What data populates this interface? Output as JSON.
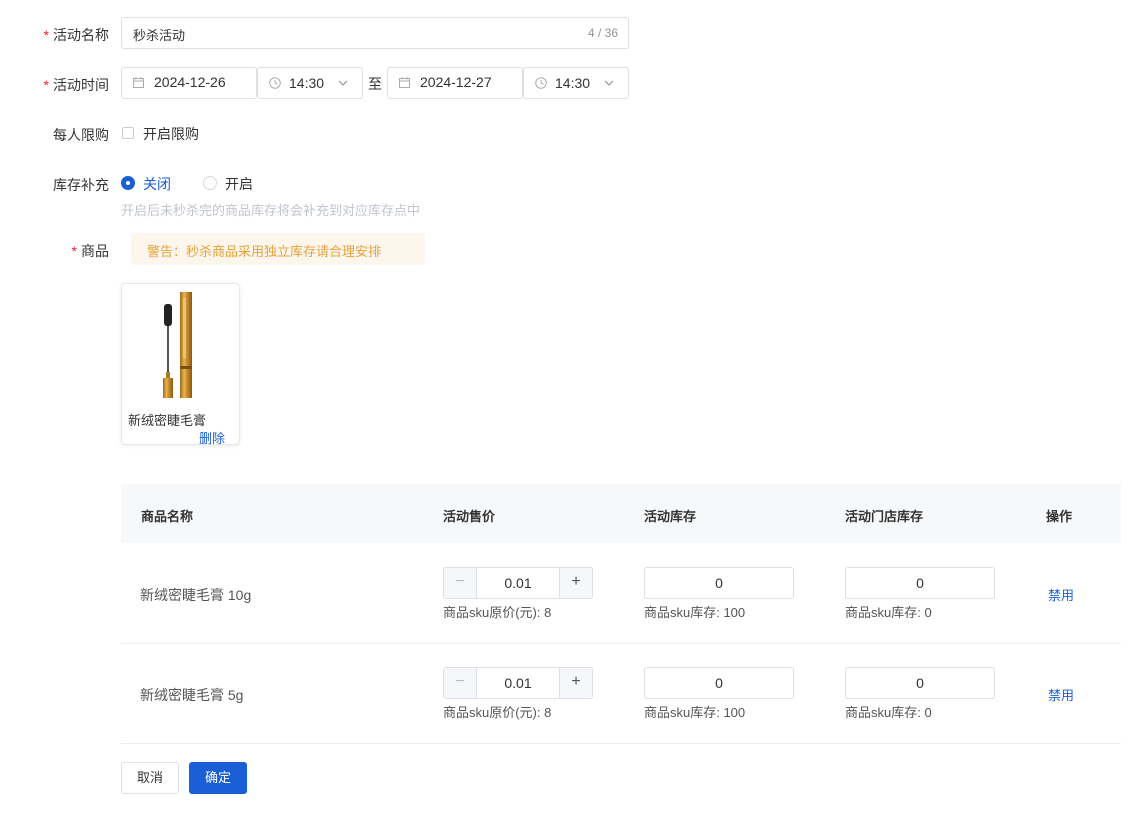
{
  "form": {
    "activity_name": {
      "label": "活动名称",
      "required_mark": "*",
      "value": "秒杀活动",
      "count": "4 / 36"
    },
    "activity_time": {
      "label": "活动时间",
      "required_mark": "*",
      "start_date": "2024-12-26",
      "start_time": "14:30",
      "separator": "至",
      "end_date": "2024-12-27",
      "end_time": "14:30"
    },
    "purchase_limit": {
      "label": "每人限购",
      "checkbox_label": "开启限购",
      "checked": false
    },
    "stock_replenish": {
      "label": "库存补充",
      "options": [
        "关闭",
        "开启"
      ],
      "selected": "关闭",
      "help": "开启后未秒杀完的商品库存将会补充到对应库存点中"
    },
    "goods": {
      "label": "商品",
      "required_mark": "*",
      "warning": "警告：秒杀商品采用独立库存请合理安排"
    }
  },
  "product_card": {
    "name": "新绒密睫毛膏",
    "delete_label": "删除",
    "image_icon": "mascara-image"
  },
  "table": {
    "headers": [
      "商品名称",
      "活动售价",
      "活动库存",
      "活动门店库存",
      "操作"
    ],
    "rows": [
      {
        "name": "新绒密睫毛膏 10g",
        "price": "0.01",
        "price_note": "商品sku原价(元): 8",
        "stock": "0",
        "stock_note": "商品sku库存: 100",
        "store_stock": "0",
        "store_note": "商品sku库存: 0",
        "action": "禁用"
      },
      {
        "name": "新绒密睫毛膏 5g",
        "price": "0.01",
        "price_note": "商品sku原价(元): 8",
        "stock": "0",
        "stock_note": "商品sku库存: 100",
        "store_stock": "0",
        "store_note": "商品sku库存: 0",
        "action": "禁用"
      }
    ]
  },
  "buttons": {
    "cancel": "取消",
    "confirm": "确定"
  },
  "colors": {
    "primary": "#1a5fd6",
    "required": "#f5222d",
    "warning_text": "#e6a23c",
    "warning_bg": "#fdf6ec"
  }
}
